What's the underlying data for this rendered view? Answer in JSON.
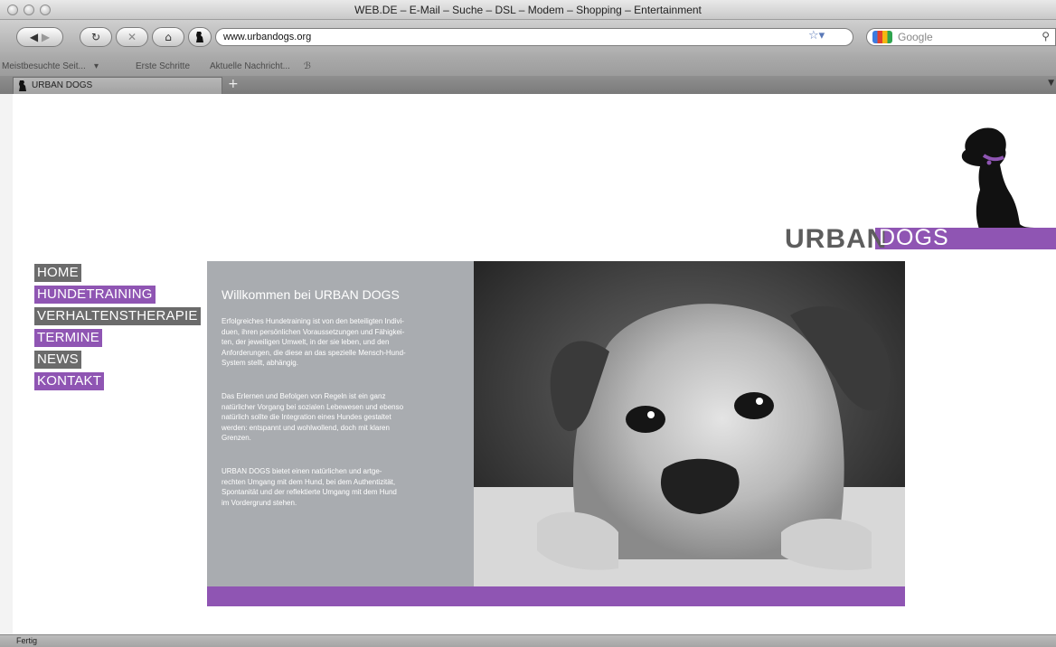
{
  "window": {
    "title": "WEB.DE – E-Mail – Suche – DSL – Modem – Shopping – Entertainment"
  },
  "toolbar": {
    "url": "www.urbandogs.org",
    "search_placeholder": "Google"
  },
  "bookmarks": [
    "Meistbesuchte Seit...",
    "Erste Schritte",
    "Aktuelle Nachricht..."
  ],
  "tabs": {
    "active": "URBAN DOGS",
    "new_tab": "+"
  },
  "logo": {
    "urban": "URBAN",
    "dogs": "DOGS"
  },
  "nav": [
    {
      "label": "HOME",
      "style": "grey"
    },
    {
      "label": "HUNDETRAINING",
      "style": "purple"
    },
    {
      "label": "VERHALTENSTHERAPIE",
      "style": "grey"
    },
    {
      "label": "TERMINE",
      "style": "purple"
    },
    {
      "label": "NEWS",
      "style": "grey"
    },
    {
      "label": "KONTAKT",
      "style": "purple"
    }
  ],
  "content": {
    "heading": "Willkommen bei URBAN DOGS",
    "paragraphs": [
      "Erfolgreiches Hundetraining ist von den beteiligten Indivi-\nduen, ihren persönlichen Voraussetzungen und Fähigkei-\nten, der jeweiligen Umwelt, in der sie leben, und den\nAnforderungen, die diese an das spezielle Mensch-Hund-\nSystem stellt, abhängig.",
      "Das Erlernen und Befolgen von Regeln ist ein ganz\nnatürlicher Vorgang bei sozialen Lebewesen und ebenso\nnatürlich sollte die Integration eines Hundes gestaltet\nwerden: entspannt und wohlwollend, doch mit klaren\nGrenzen.",
      "URBAN DOGS bietet einen natürlichen und artge-\nrechten Umgang mit dem Hund, bei dem Authentizität,\nSpontanität und der reflektierte Umgang mit dem Hund\nim Vordergrund stehen."
    ]
  },
  "colors": {
    "accent": "#8f55b3",
    "grey": "#6b6b6b",
    "panel": "#a9acb0"
  },
  "status": {
    "text": "Fertig"
  }
}
